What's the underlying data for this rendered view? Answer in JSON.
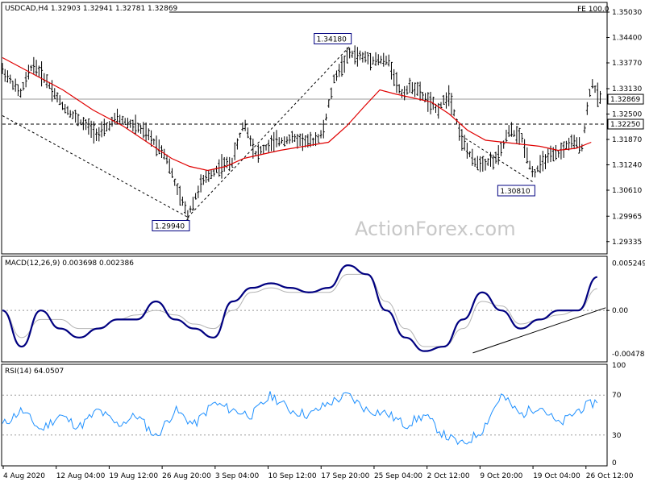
{
  "header": {
    "symbol_info": "USDCAD,H4 1.32903 1.32941 1.32781 1.32869",
    "fe_label": "FE 100.0"
  },
  "watermark": "ActionForex.com",
  "colors": {
    "background": "#ffffff",
    "price_bars": "#000000",
    "moving_average": "#e00000",
    "macd_main": "#000080",
    "macd_signal": "#b4b4b4",
    "rsi_line": "#1e90ff",
    "pane_border": "#000000",
    "label_box": "#000080"
  },
  "chart_data": [
    {
      "type": "line",
      "pane": "price",
      "y_ticks": [
        "1.35030",
        "1.34400",
        "1.33770",
        "1.33130",
        "1.32500",
        "1.31870",
        "1.31240",
        "1.30610",
        "1.29965",
        "1.29335"
      ],
      "ylim": [
        1.2905,
        1.3525
      ],
      "current_price_label": "1.32869",
      "current_price": 1.32869,
      "level_label": "1.32250",
      "level": 1.3225,
      "fe_level": 1.3503,
      "annotations": [
        {
          "label": "1.29940",
          "value": 1.2994,
          "x": 0.307
        },
        {
          "label": "1.34180",
          "value": 1.3418,
          "x": 0.575
        },
        {
          "label": "1.30810",
          "value": 1.3081,
          "x": 0.879
        }
      ],
      "trendlines": [
        {
          "from": {
            "x": 0.0,
            "y": 1.3246
          },
          "to": {
            "x": 0.307,
            "y": 1.2994
          }
        },
        {
          "from": {
            "x": 0.307,
            "y": 1.2994
          },
          "to": {
            "x": 0.575,
            "y": 1.3418
          }
        },
        {
          "from": {
            "x": 0.76,
            "y": 1.3196
          },
          "to": {
            "x": 0.879,
            "y": 1.3081
          }
        }
      ],
      "series": [
        {
          "points": [
            [
              0.0,
              1.336
            ],
            [
              0.03,
              1.33
            ],
            [
              0.05,
              1.3375
            ],
            [
              0.07,
              1.334
            ],
            [
              0.1,
              1.327
            ],
            [
              0.13,
              1.323
            ],
            [
              0.16,
              1.32
            ],
            [
              0.19,
              1.324
            ],
            [
              0.22,
              1.322
            ],
            [
              0.24,
              1.32
            ],
            [
              0.27,
              1.315
            ],
            [
              0.29,
              1.306
            ],
            [
              0.307,
              1.3
            ],
            [
              0.33,
              1.308
            ],
            [
              0.36,
              1.312
            ],
            [
              0.38,
              1.313
            ],
            [
              0.4,
              1.323
            ],
            [
              0.42,
              1.315
            ],
            [
              0.45,
              1.318
            ],
            [
              0.48,
              1.319
            ],
            [
              0.51,
              1.318
            ],
            [
              0.53,
              1.32
            ],
            [
              0.55,
              1.334
            ],
            [
              0.575,
              1.34
            ],
            [
              0.6,
              1.339
            ],
            [
              0.62,
              1.3385
            ],
            [
              0.64,
              1.338
            ],
            [
              0.66,
              1.33
            ],
            [
              0.68,
              1.332
            ],
            [
              0.7,
              1.329
            ],
            [
              0.72,
              1.326
            ],
            [
              0.74,
              1.33
            ],
            [
              0.76,
              1.319
            ],
            [
              0.78,
              1.313
            ],
            [
              0.8,
              1.313
            ],
            [
              0.82,
              1.314
            ],
            [
              0.84,
              1.321
            ],
            [
              0.86,
              1.319
            ],
            [
              0.879,
              1.31
            ],
            [
              0.9,
              1.314
            ],
            [
              0.92,
              1.315
            ],
            [
              0.94,
              1.318
            ],
            [
              0.96,
              1.317
            ],
            [
              0.975,
              1.333
            ],
            [
              0.99,
              1.3287
            ]
          ]
        },
        {
          "points": [
            [
              0.0,
              1.339
            ],
            [
              0.05,
              1.335
            ],
            [
              0.1,
              1.331
            ],
            [
              0.15,
              1.326
            ],
            [
              0.2,
              1.322
            ],
            [
              0.25,
              1.317
            ],
            [
              0.28,
              1.314
            ],
            [
              0.31,
              1.312
            ],
            [
              0.34,
              1.311
            ],
            [
              0.37,
              1.312
            ],
            [
              0.4,
              1.314
            ],
            [
              0.43,
              1.315
            ],
            [
              0.46,
              1.316
            ],
            [
              0.5,
              1.317
            ],
            [
              0.54,
              1.318
            ],
            [
              0.57,
              1.322
            ],
            [
              0.6,
              1.327
            ],
            [
              0.625,
              1.331
            ],
            [
              0.65,
              1.33
            ],
            [
              0.68,
              1.329
            ],
            [
              0.71,
              1.328
            ],
            [
              0.74,
              1.325
            ],
            [
              0.77,
              1.321
            ],
            [
              0.8,
              1.3185
            ],
            [
              0.83,
              1.318
            ],
            [
              0.86,
              1.3175
            ],
            [
              0.89,
              1.317
            ],
            [
              0.92,
              1.316
            ],
            [
              0.95,
              1.3165
            ],
            [
              0.975,
              1.318
            ]
          ]
        }
      ]
    },
    {
      "type": "line",
      "pane": "macd",
      "title": "MACD(12,26,9) 0.003698 0.002386",
      "y_ticks": [
        "0.005249",
        "0.00",
        "-0.004785"
      ],
      "ylim": [
        -0.0056,
        0.0059
      ],
      "series": [
        {
          "values": [
            0.0,
            -0.004,
            0.0,
            -0.002,
            -0.003,
            -0.002,
            -0.001,
            -0.001,
            0.001,
            -0.001,
            -0.002,
            -0.003,
            0.001,
            0.0025,
            0.003,
            0.0025,
            0.002,
            0.0025,
            0.005,
            0.004,
            0.0,
            -0.003,
            -0.0045,
            -0.004,
            -0.001,
            0.002,
            0.0,
            -0.002,
            -0.001,
            0.0,
            0.0,
            0.0037
          ]
        },
        {
          "values": [
            0.0,
            -0.003,
            -0.001,
            -0.001,
            -0.002,
            -0.002,
            -0.001,
            -0.0005,
            0.0,
            -0.0005,
            -0.0015,
            -0.002,
            0.0,
            0.002,
            0.0025,
            0.002,
            0.002,
            0.002,
            0.004,
            0.004,
            0.001,
            -0.002,
            -0.004,
            -0.004,
            -0.002,
            0.001,
            0.0005,
            -0.0015,
            -0.001,
            -0.0005,
            0.0,
            0.0024
          ]
        }
      ],
      "trendline": {
        "from": {
          "x": 0.779,
          "y": -0.0047
        },
        "to": {
          "x": 0.999,
          "y": 0.0003
        }
      }
    },
    {
      "type": "line",
      "pane": "rsi",
      "title": "RSI(14) 64.0507",
      "y_ticks": [
        "100",
        "70",
        "30",
        "0"
      ],
      "ylim": [
        0,
        100
      ],
      "levels": [
        70,
        30
      ],
      "series": [
        {
          "values": [
            40,
            55,
            35,
            50,
            38,
            55,
            40,
            50,
            28,
            55,
            40,
            62,
            55,
            50,
            70,
            55,
            50,
            62,
            70,
            55,
            52,
            40,
            50,
            30,
            20,
            35,
            70,
            50,
            60,
            40,
            55,
            64
          ]
        }
      ]
    }
  ],
  "x_axis": {
    "labels": [
      "4 Aug 2020",
      "12 Aug 04:00",
      "19 Aug 12:00",
      "26 Aug 20:00",
      "3 Sep 04:00",
      "10 Sep 12:00",
      "17 Sep 20:00",
      "25 Sep 04:00",
      "2 Oct 12:00",
      "9 Oct 20:00",
      "19 Oct 04:00",
      "26 Oct 12:00"
    ]
  }
}
